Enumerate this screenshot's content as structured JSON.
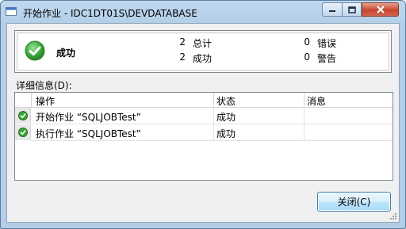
{
  "window": {
    "title": "开始作业 - IDC1DT01S\\DEVDATABASE",
    "icon": "job-window-icon",
    "controls": {
      "minimize": "minimize-icon",
      "maximize": "maximize-icon",
      "close": "close-icon"
    }
  },
  "summary": {
    "status": "成功",
    "status_icon": "success-check-icon",
    "total_count": "2",
    "total_label": "总计",
    "success_count": "2",
    "success_label": "成功",
    "error_count": "0",
    "error_label": "错误",
    "warning_count": "0",
    "warning_label": "警告"
  },
  "details_label": "详细信息(D):",
  "grid": {
    "columns": [
      "操作",
      "状态",
      "消息"
    ],
    "rows": [
      {
        "action": "开始作业 “SQLJOBTest”",
        "status": "成功",
        "message": "",
        "icon": "success-check-icon"
      },
      {
        "action": "执行作业 “SQLJOBTest”",
        "status": "成功",
        "message": "",
        "icon": "success-check-icon"
      }
    ]
  },
  "close_button": "关闭(C)",
  "colors": {
    "success": "#3aa63a",
    "title_bar": "#bfd8ee",
    "button_border": "#3c7fb1"
  }
}
